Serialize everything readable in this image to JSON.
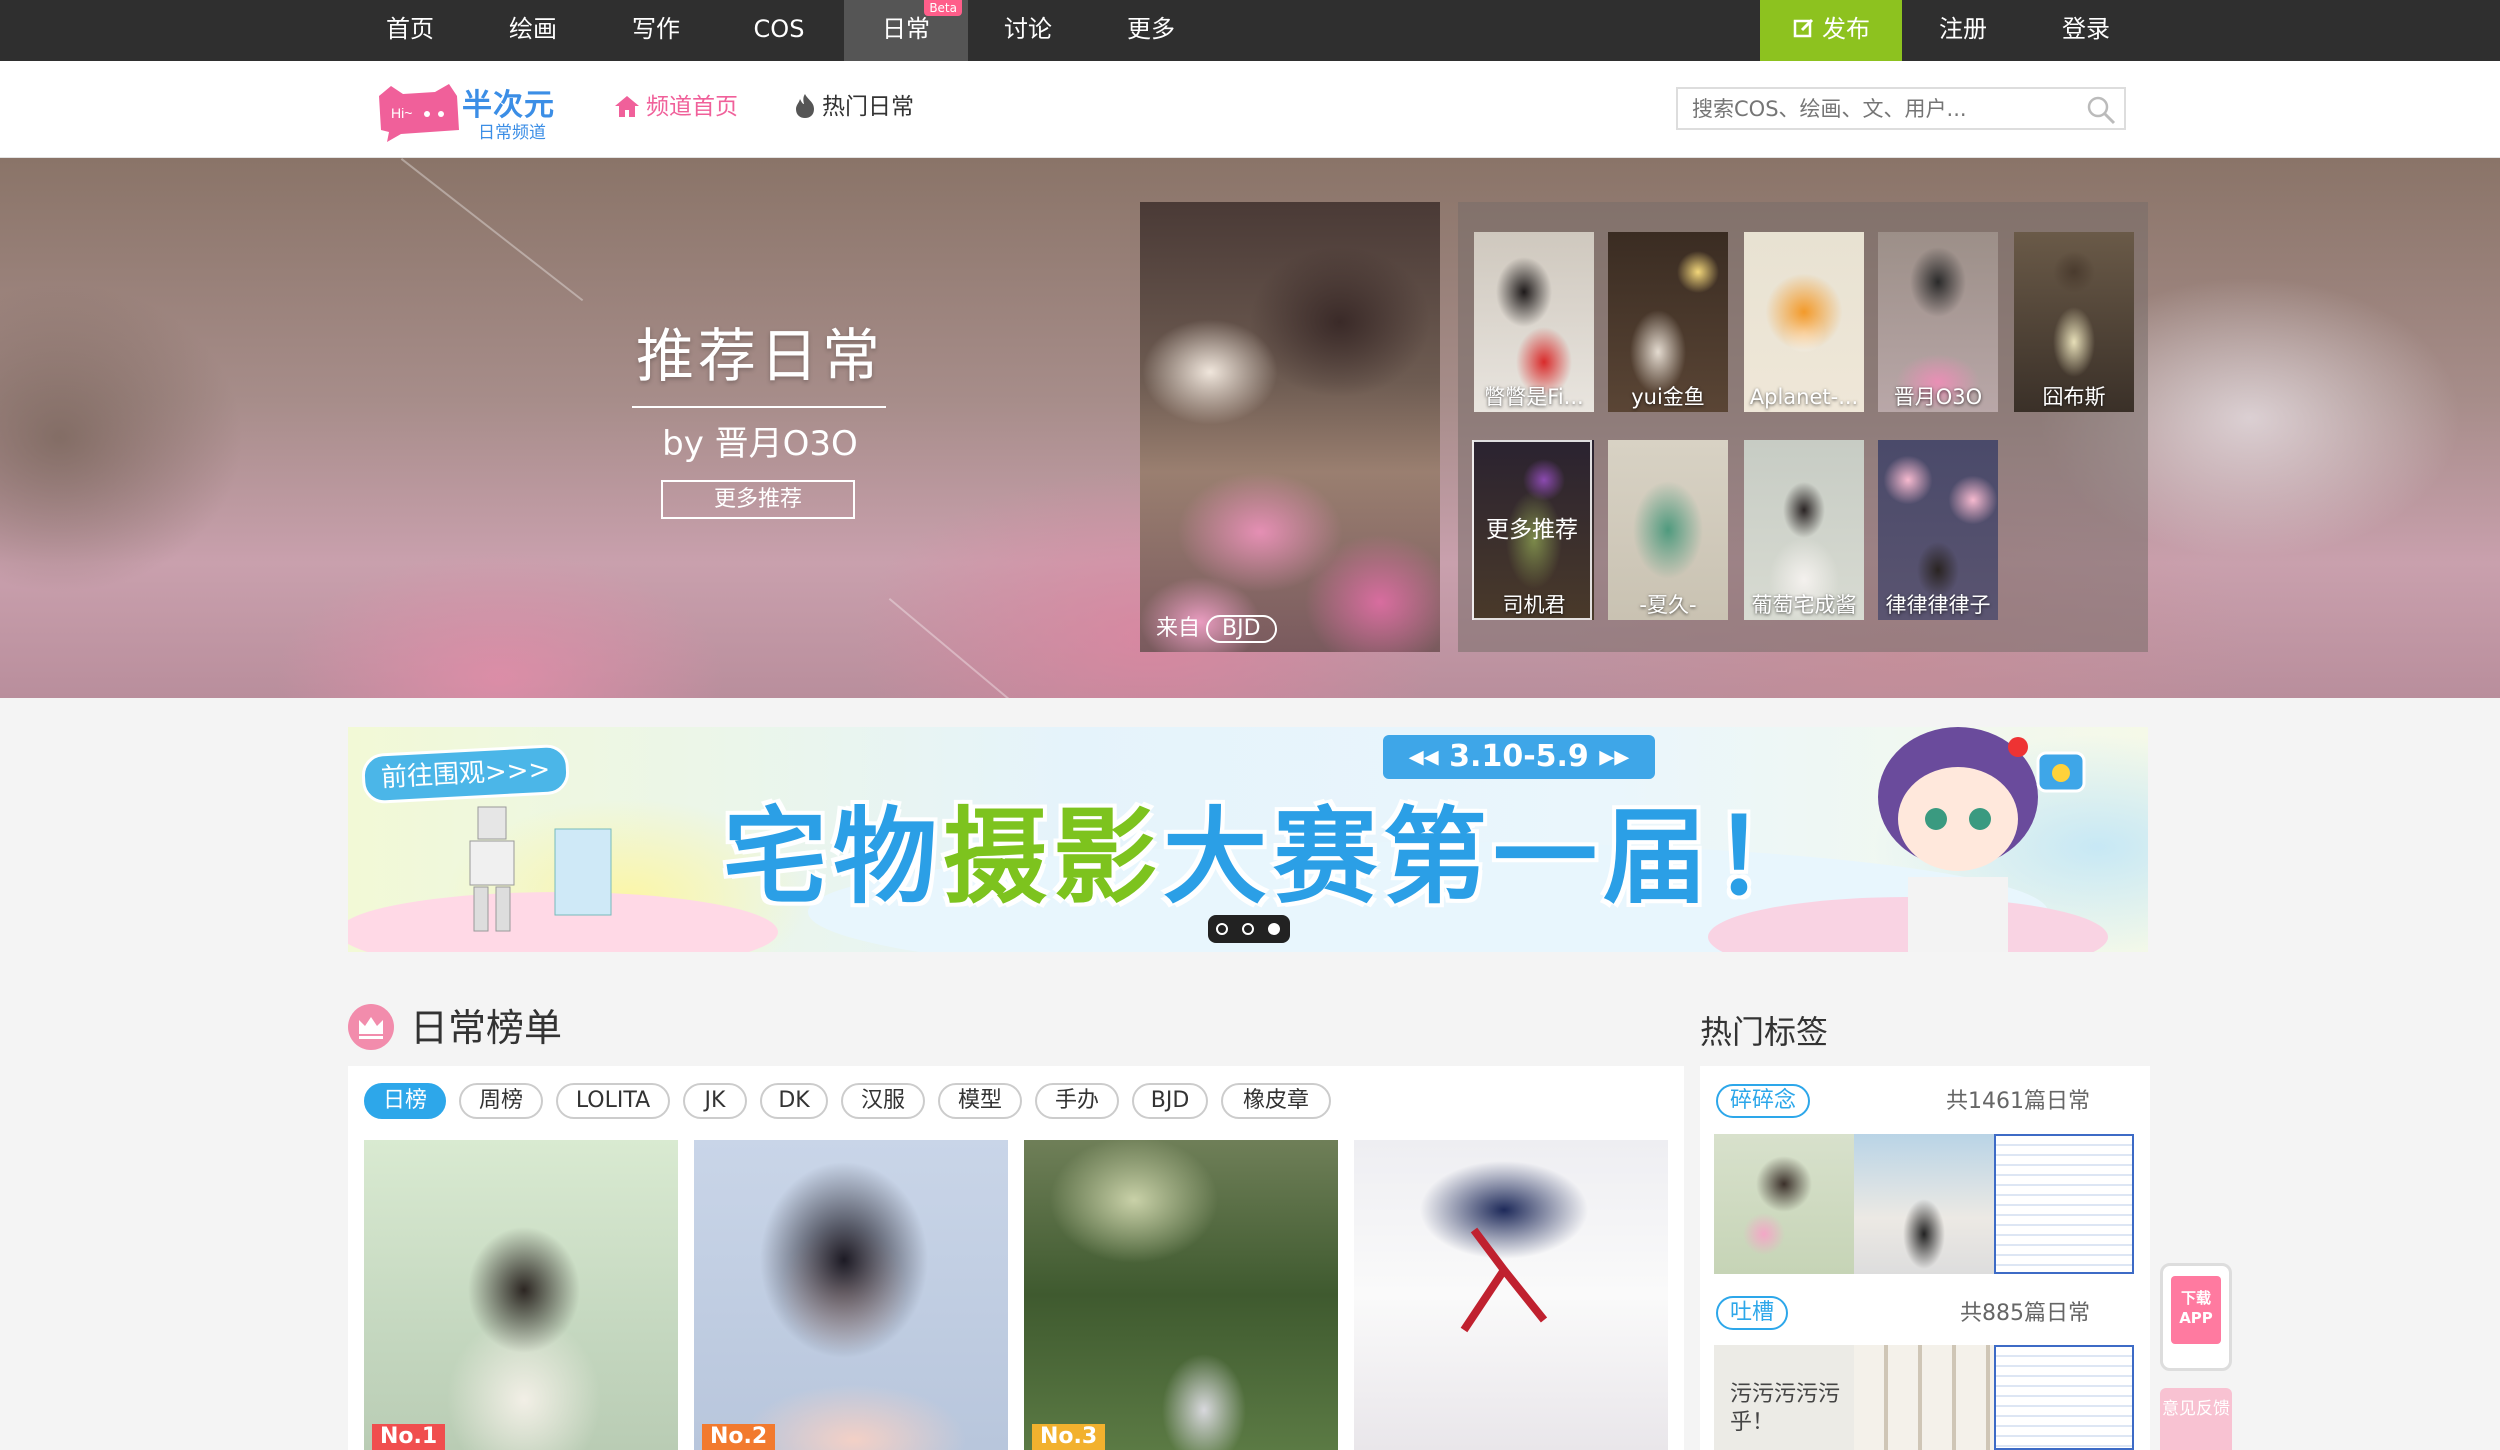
{
  "topnav": {
    "items": [
      "首页",
      "绘画",
      "写作",
      "COS",
      "日常",
      "讨论",
      "更多"
    ],
    "beta_badge": "Beta",
    "publish": "发布",
    "register": "注册",
    "login": "登录"
  },
  "channel": {
    "logo_name": "半次元",
    "logo_sub": "日常频道",
    "logo_badge": "Hi~",
    "nav_home": "频道首页",
    "nav_hot": "热门日常",
    "search_placeholder": "搜索COS、绘画、文、用户..."
  },
  "hero": {
    "title": "推荐日常",
    "by": "by 晋月O3O",
    "more": "更多推荐",
    "feature_from": "来自",
    "feature_tag": "BJD",
    "thumbs": [
      {
        "caption": "瞥瞥是Fi..."
      },
      {
        "caption": "yui金鱼"
      },
      {
        "caption": "Aplanet-..."
      },
      {
        "caption": "晋月O3O"
      },
      {
        "caption": "囧布斯"
      },
      {
        "caption": "司机君"
      },
      {
        "caption": "-夏久-"
      },
      {
        "caption": "葡萄宅成酱"
      },
      {
        "caption": "律律律律子"
      }
    ],
    "thumbs_more": "更多推荐"
  },
  "banner": {
    "tag": "前往围观>>>",
    "date": "◂◂ 3.10-5.9 ▸▸",
    "title_a": "宅物",
    "title_b": "摄影",
    "title_c": "大赛第一届！"
  },
  "ranking": {
    "title": "日常榜单",
    "tabs": [
      "日榜",
      "周榜",
      "LOLITA",
      "JK",
      "DK",
      "汉服",
      "模型",
      "手办",
      "BJD",
      "橡皮章"
    ],
    "items": [
      {
        "no": "No.1"
      },
      {
        "no": "No.2"
      },
      {
        "no": "No.3"
      },
      {
        "no": ""
      }
    ]
  },
  "hot_tags": {
    "title": "热门标签",
    "tags": [
      {
        "name": "碎碎念",
        "count": "共1461篇日常"
      },
      {
        "name": "吐槽",
        "count": "共885篇日常"
      }
    ],
    "tucao_text": "污污污污污乎！"
  },
  "floats": {
    "app": "下载APP",
    "feedback": "意见反馈"
  },
  "colors": {
    "topnav_bg": "#2f2f2f",
    "publish_green": "#8dc21f",
    "accent_pink": "#ff5e8a",
    "accent_blue": "#2da7ea"
  }
}
